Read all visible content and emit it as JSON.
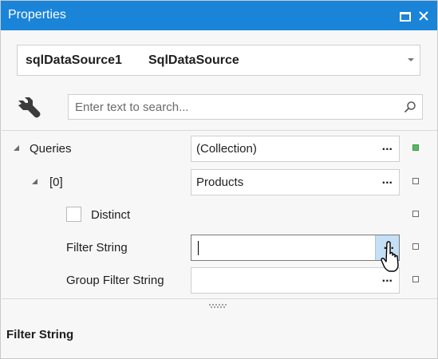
{
  "window": {
    "title": "Properties",
    "accent_color": "#1a84d8",
    "buttons": [
      "maximize-icon",
      "close-icon"
    ]
  },
  "object_selector": {
    "name": "sqlDataSource1",
    "type": "SqlDataSource"
  },
  "search": {
    "placeholder": "Enter text to search...",
    "value": ""
  },
  "properties": [
    {
      "label": "Queries",
      "value": "(Collection)",
      "expanded": true,
      "level": 0,
      "has_ellipsis": true,
      "marker": "modified"
    },
    {
      "label": "[0]",
      "value": "Products",
      "expanded": true,
      "level": 1,
      "has_ellipsis": true,
      "marker": "default"
    },
    {
      "label": "Distinct",
      "type": "checkbox",
      "checked": false,
      "level": 2,
      "marker": "default"
    },
    {
      "label": "Filter String",
      "value": "",
      "level": 2,
      "editing": true,
      "has_ellipsis": true,
      "marker": "default"
    },
    {
      "label": "Group Filter String",
      "value": "",
      "level": 2,
      "has_ellipsis": true,
      "marker": "default"
    }
  ],
  "ellipsis": "...",
  "description": {
    "title": "Filter String"
  }
}
